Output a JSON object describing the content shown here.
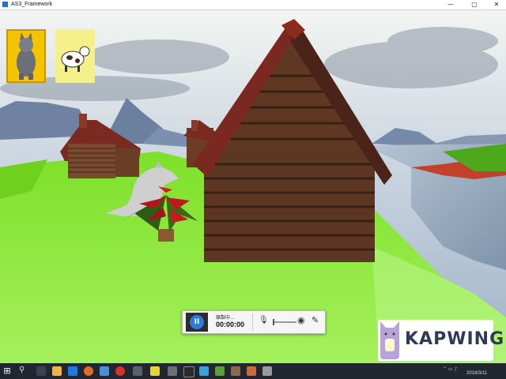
{
  "window": {
    "title": "AS3_Framework",
    "minimize_glyph": "—",
    "maximize_glyph": "▢",
    "close_glyph": "✕"
  },
  "hud": {
    "portraits": [
      {
        "name": "wolf-portrait-icon"
      },
      {
        "name": "cow-portrait-icon"
      }
    ]
  },
  "recorder": {
    "pause_glyph": "II",
    "status": "錄製中...",
    "time": "00:00:00",
    "mic_glyph": "🎙",
    "camera_glyph": "◉",
    "pen_glyph": "✎"
  },
  "watermark": {
    "text": "KAPWING"
  },
  "taskbar": {
    "start_glyph": "⊞",
    "search_glyph": "⚲",
    "date": "2019/3/11",
    "icons": [
      "task-view-icon",
      "explorer-icon",
      "chrome-icon",
      "firefox-icon",
      "app-icon",
      "app-icon",
      "app-icon",
      "app-icon",
      "app-icon",
      "app-icon",
      "app-icon",
      "app-icon"
    ]
  },
  "colors": {
    "sky": "#aebfd6",
    "grass": "#8fe83a",
    "water": "#9fb4c8",
    "log": "#5a3522",
    "roof": "#8c2a1c",
    "portrait_gold": "#f4c400",
    "recorder_accent": "#2f7ad8",
    "kapwing_text": "#2f3b56"
  }
}
